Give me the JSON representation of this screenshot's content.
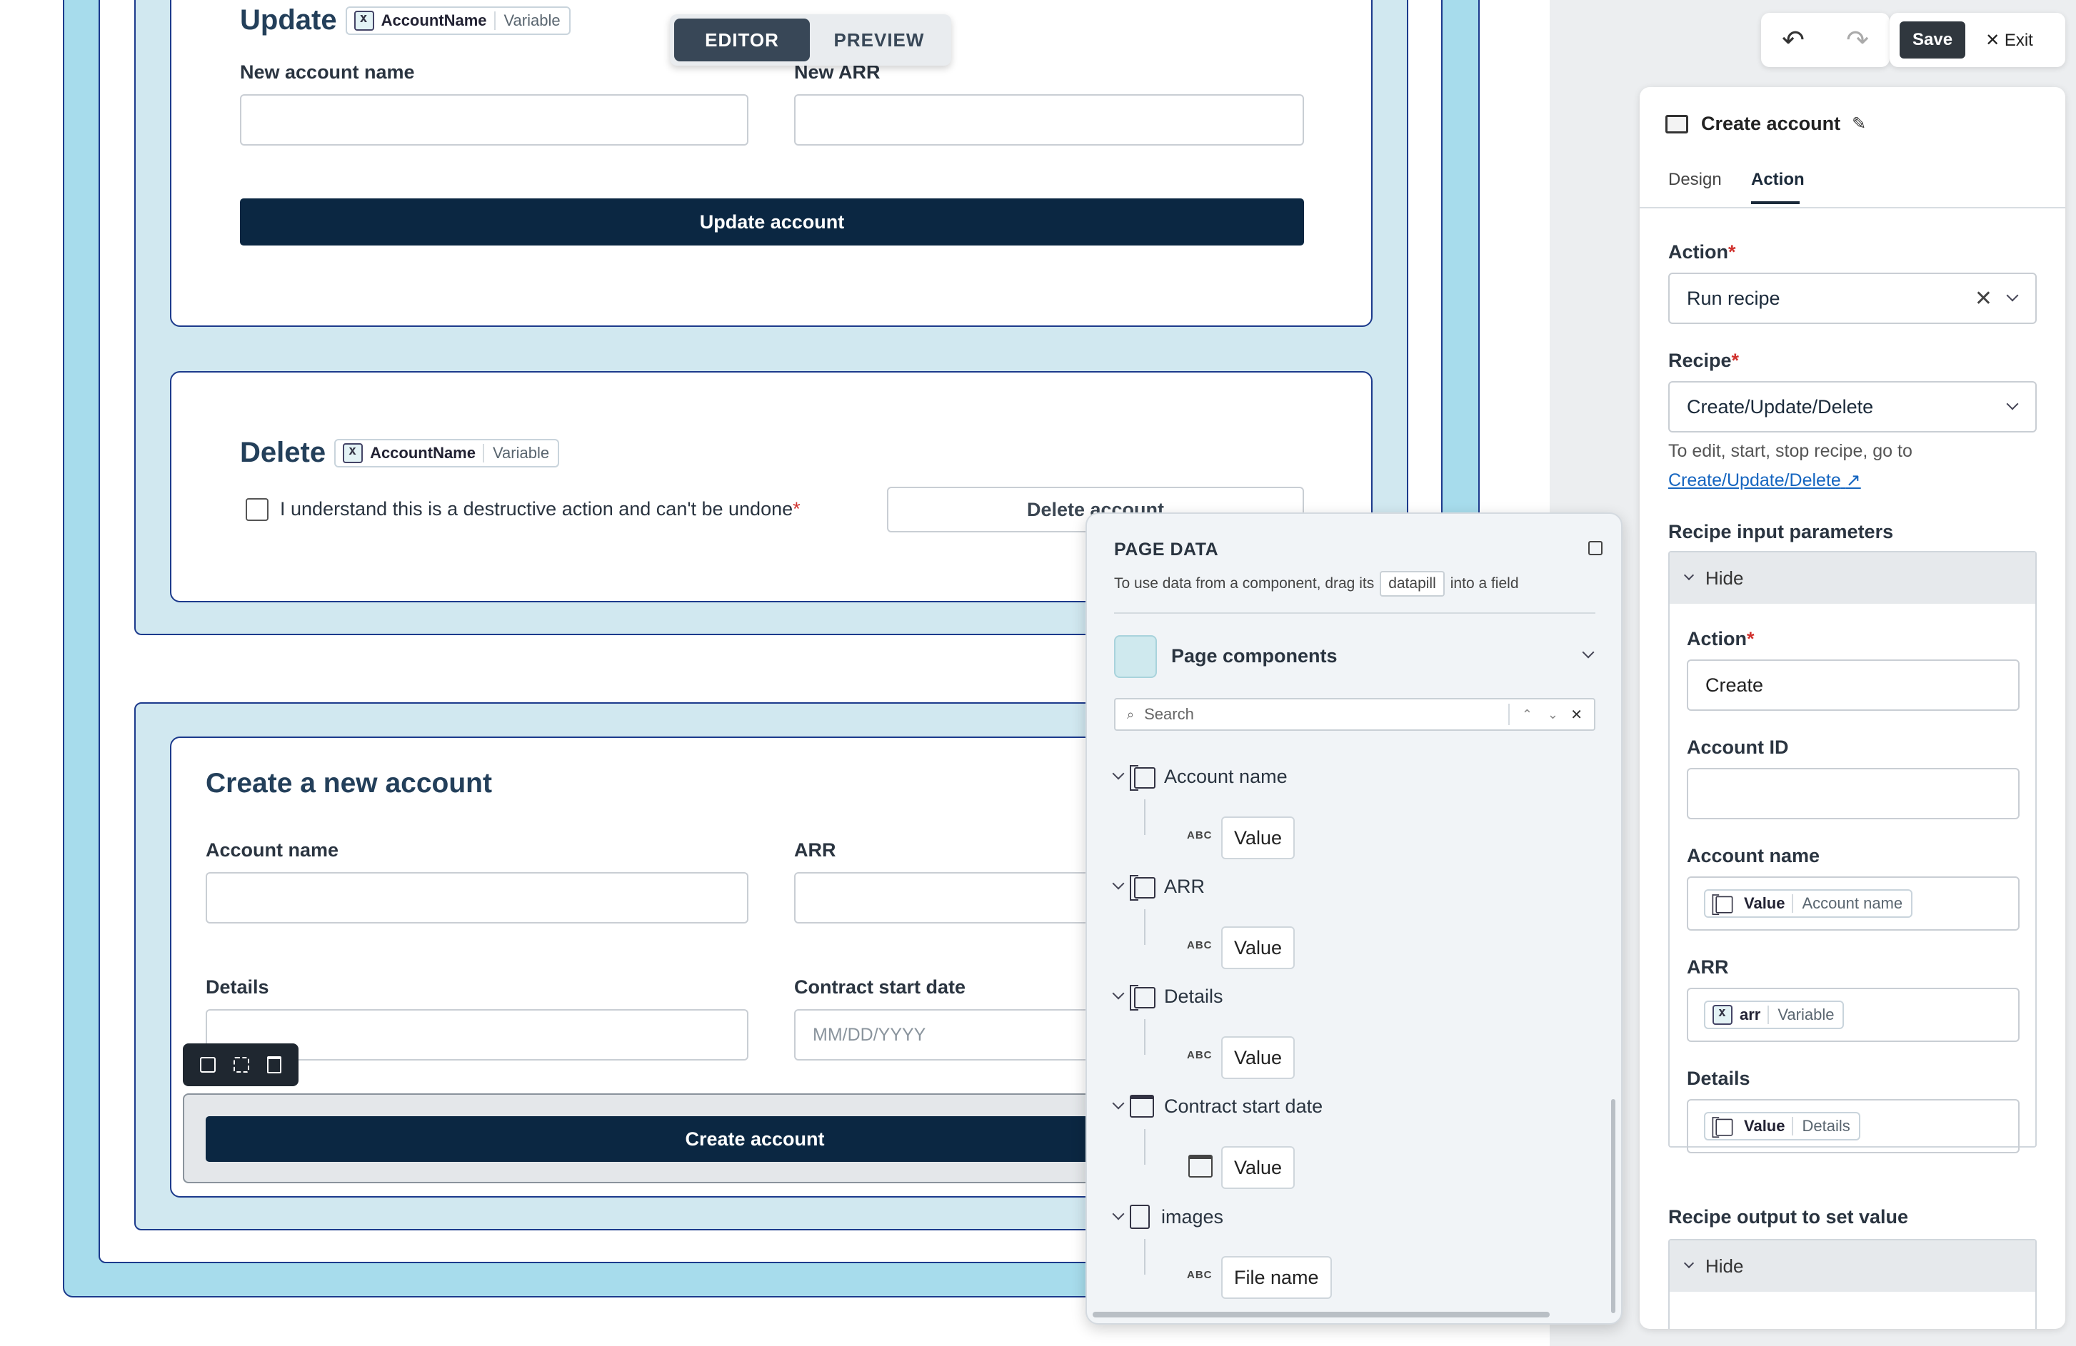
{
  "toggle": {
    "editor": "EDITOR",
    "preview": "PREVIEW"
  },
  "toolbar": {
    "save": "Save",
    "exit": "Exit"
  },
  "update_card": {
    "title": "Update",
    "pill_name": "AccountName",
    "pill_type": "Variable",
    "new_name_label": "New account name",
    "new_arr_label": "New ARR",
    "button": "Update account"
  },
  "delete_card": {
    "title": "Delete",
    "pill_name": "AccountName",
    "pill_type": "Variable",
    "checkbox_label": "I understand this is a destructive action and can't be undone",
    "button": "Delete account"
  },
  "create_card": {
    "title": "Create a new account",
    "account_name_label": "Account name",
    "arr_label": "ARR",
    "details_label": "Details",
    "contract_label": "Contract start date",
    "contract_placeholder": "MM/DD/YYYY",
    "button": "Create account"
  },
  "page_data": {
    "title": "PAGE DATA",
    "hint_pre": "To use data from a component, drag its",
    "hint_pill": "datapill",
    "hint_post": "into a field",
    "section": "Page components",
    "search_placeholder": "Search",
    "items": [
      {
        "name": "Account name",
        "value": "Value"
      },
      {
        "name": "ARR",
        "value": "Value"
      },
      {
        "name": "Details",
        "value": "Value"
      },
      {
        "name": "Contract start date",
        "value": "Value"
      },
      {
        "name": "images",
        "value": "File name"
      }
    ],
    "abc": "ABC"
  },
  "right_panel": {
    "title": "Create account",
    "tabs": [
      "Design",
      "Action"
    ],
    "active_tab": "Action",
    "action_label": "Action",
    "action_value": "Run recipe",
    "recipe_label": "Recipe",
    "recipe_value": "Create/Update/Delete",
    "recipe_hint": "To edit, start, stop recipe, go to",
    "recipe_link": "Create/Update/Delete",
    "input_params_label": "Recipe input parameters",
    "hide": "Hide",
    "inner_action_label": "Action",
    "inner_action_value": "Create",
    "account_id_label": "Account ID",
    "account_name_label": "Account name",
    "account_name_pill": {
      "name": "Value",
      "type": "Account name"
    },
    "arr_label": "ARR",
    "arr_pill": {
      "name": "arr",
      "type": "Variable"
    },
    "details_label": "Details",
    "details_pill": {
      "name": "Value",
      "type": "Details"
    },
    "output_label": "Recipe output to set value",
    "hide2": "Hide"
  },
  "colors": {
    "accent": "#0b2742",
    "canvas_frame": "#a7dcec",
    "link": "#1565c0"
  }
}
